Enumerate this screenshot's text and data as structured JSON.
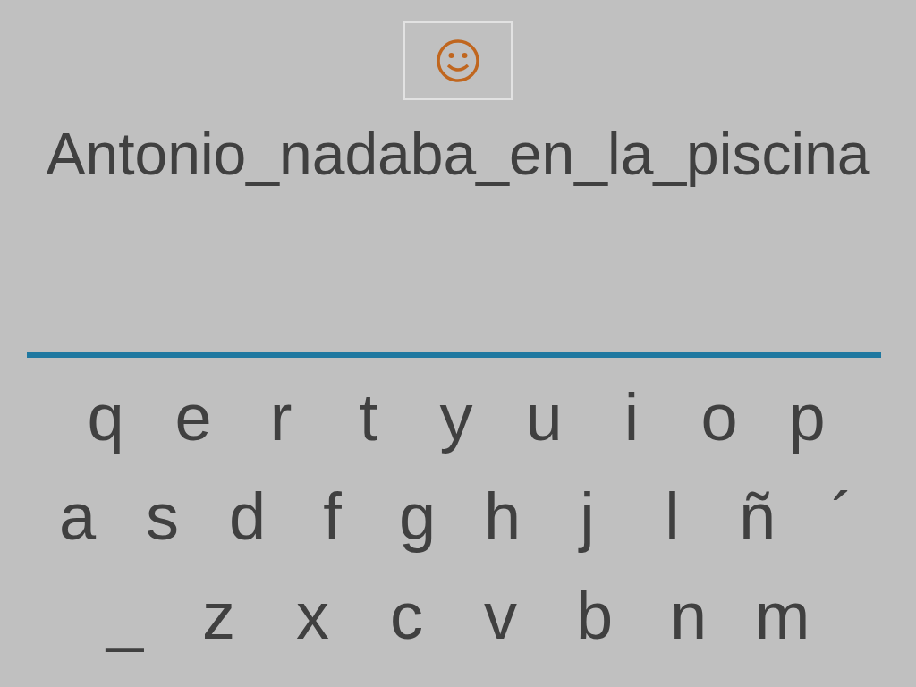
{
  "sentence": "Antonio_nadaba_en_la_piscina",
  "keyboard": [
    [
      "q",
      "e",
      "r",
      "t",
      "y",
      "u",
      "i",
      "o",
      "p"
    ],
    [
      "a",
      "s",
      "d",
      "f",
      "g",
      "h",
      "j",
      "l",
      "ñ",
      "´"
    ],
    [
      "_",
      "z",
      "x",
      "c",
      "v",
      "b",
      "n",
      "m"
    ]
  ]
}
